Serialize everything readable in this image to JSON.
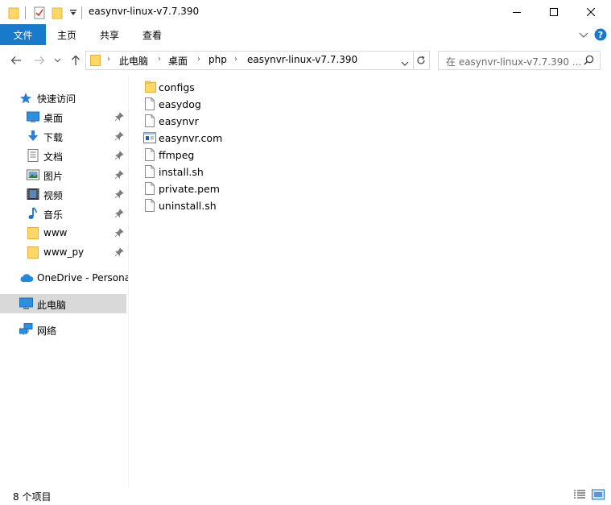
{
  "window": {
    "title": "easynvr-linux-v7.7.390"
  },
  "ribbon": {
    "tabs": [
      "文件",
      "主页",
      "共享",
      "查看"
    ]
  },
  "address": {
    "crumbs": [
      "此电脑",
      "桌面",
      "php",
      "easynvr-linux-v7.7.390"
    ]
  },
  "search": {
    "placeholder": "在 easynvr-linux-v7.7.390 ..."
  },
  "nav": {
    "quick_access": "快速访问",
    "quick_items": [
      {
        "label": "桌面",
        "icon": "desktop-icon"
      },
      {
        "label": "下载",
        "icon": "download-icon"
      },
      {
        "label": "文档",
        "icon": "document-icon"
      },
      {
        "label": "图片",
        "icon": "pictures-icon"
      },
      {
        "label": "视频",
        "icon": "video-icon"
      },
      {
        "label": "音乐",
        "icon": "music-icon"
      },
      {
        "label": "www",
        "icon": "folder-icon"
      },
      {
        "label": "www_py",
        "icon": "folder-icon"
      }
    ],
    "onedrive": "OneDrive - Persona",
    "this_pc": "此电脑",
    "network": "网络"
  },
  "files": [
    {
      "name": "configs",
      "icon": "folder-icon"
    },
    {
      "name": "easydog",
      "icon": "file-icon"
    },
    {
      "name": "easynvr",
      "icon": "file-icon"
    },
    {
      "name": "easynvr.com",
      "icon": "app-file-icon"
    },
    {
      "name": "ffmpeg",
      "icon": "file-icon"
    },
    {
      "name": "install.sh",
      "icon": "file-icon"
    },
    {
      "name": "private.pem",
      "icon": "file-icon"
    },
    {
      "name": "uninstall.sh",
      "icon": "file-icon"
    }
  ],
  "status": {
    "item_count": "8 个项目"
  },
  "colors": {
    "accent": "#1979ca",
    "folder": "#ffd767",
    "selected": "#d9d9d9"
  }
}
